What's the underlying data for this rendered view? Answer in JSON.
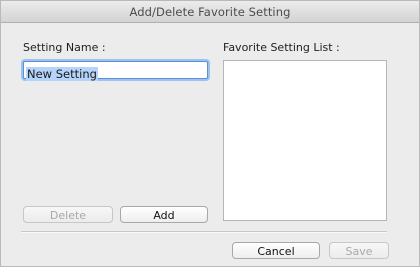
{
  "window": {
    "title": "Add/Delete Favorite Setting"
  },
  "setting_name": {
    "label": "Setting Name :",
    "value": "New Setting"
  },
  "favorite_list": {
    "label": "Favorite Setting List :",
    "items": []
  },
  "buttons": {
    "delete": "Delete",
    "add": "Add",
    "cancel": "Cancel",
    "save": "Save"
  },
  "colors": {
    "focus_ring": "#9cc2f0",
    "selection": "#b5d4fb",
    "window_bg": "#ececec"
  }
}
